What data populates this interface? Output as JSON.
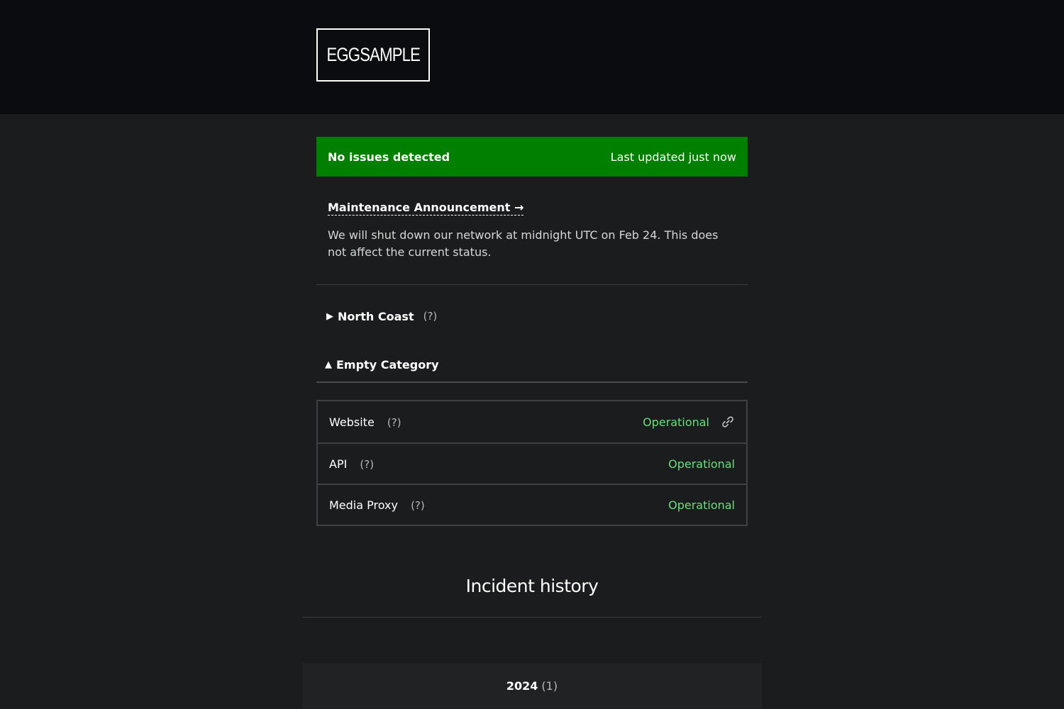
{
  "header": {
    "logo_text": "EGGSAMPLE"
  },
  "status_banner": {
    "message": "No issues detected",
    "last_updated": "Last updated just now",
    "color": "#007f00"
  },
  "announcement": {
    "link_label": "Maintenance Announcement →",
    "text": "We will shut down our network at midnight UTC on Feb 24. This does not affect the current status."
  },
  "categories": [
    {
      "name": "North Coast",
      "help": "(?)",
      "expanded": false,
      "icon": "triangle-right-icon"
    },
    {
      "name": "Empty Category",
      "expanded": true,
      "icon": "triangle-up-icon"
    }
  ],
  "services": [
    {
      "name": "Website",
      "help": "(?)",
      "status": "Operational",
      "has_link": true
    },
    {
      "name": "API",
      "help": "(?)",
      "status": "Operational",
      "has_link": false
    },
    {
      "name": "Media Proxy",
      "help": "(?)",
      "status": "Operational",
      "has_link": false
    }
  ],
  "status_color": "#66e07a",
  "incident_history": {
    "title": "Incident history",
    "years": [
      {
        "year": "2024",
        "count": "(1)"
      }
    ]
  }
}
